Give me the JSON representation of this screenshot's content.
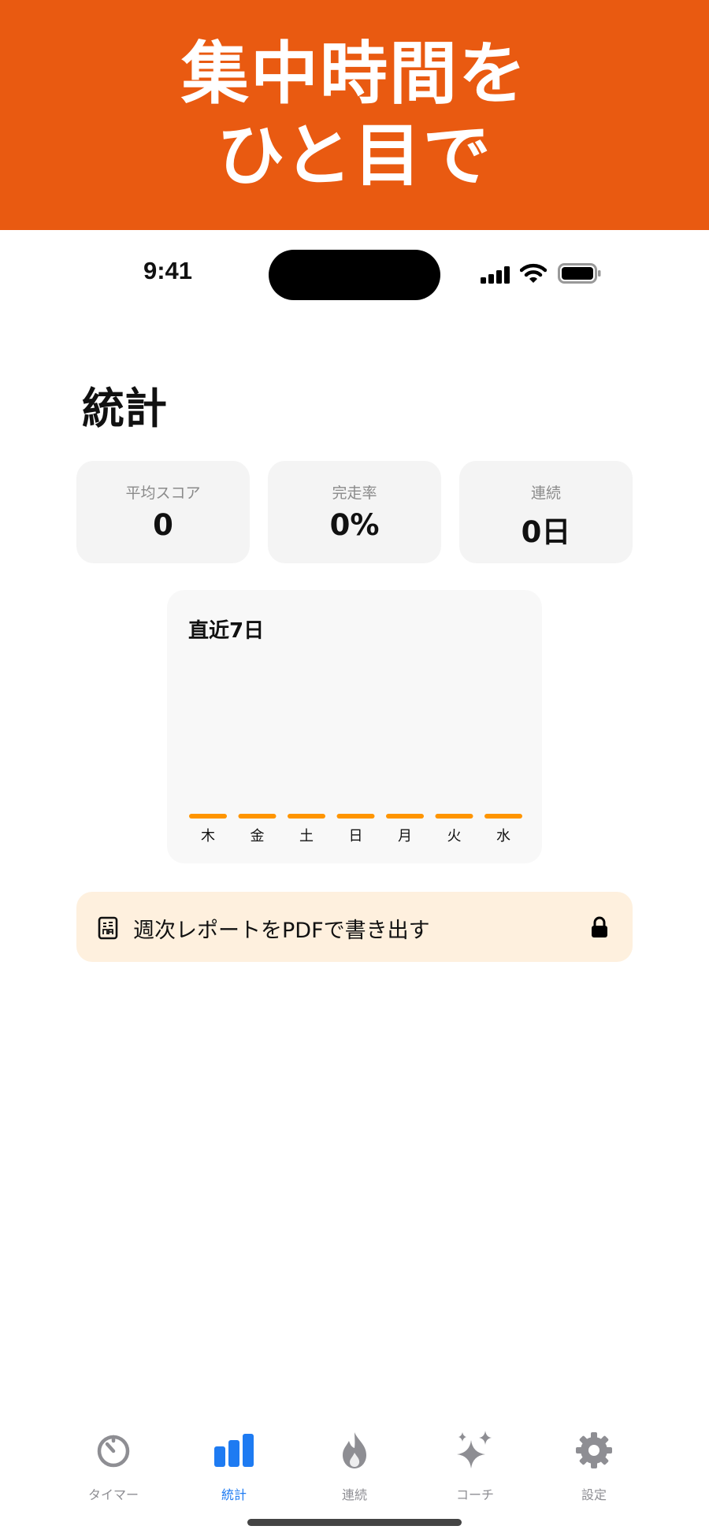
{
  "banner": {
    "line1": "集中時間を",
    "line2": "ひと目で"
  },
  "status_bar": {
    "time": "9:41"
  },
  "page": {
    "title": "統計"
  },
  "stats": [
    {
      "label": "平均スコア",
      "value": "0"
    },
    {
      "label": "完走率",
      "value": "0%"
    },
    {
      "label": "連続",
      "value": "0日"
    }
  ],
  "chart_data": {
    "type": "bar",
    "title": "直近7日",
    "categories": [
      "木",
      "金",
      "土",
      "日",
      "月",
      "火",
      "水"
    ],
    "values": [
      0,
      0,
      0,
      0,
      0,
      0,
      0
    ],
    "color": "#FF9500"
  },
  "pdf_export": {
    "label": "週次レポートをPDFで書き出す",
    "icon": "document-icon",
    "lock_icon": "lock-icon"
  },
  "tab_bar": {
    "active": "stats",
    "items": [
      {
        "key": "timer",
        "label": "タイマー",
        "icon": "timer-icon"
      },
      {
        "key": "stats",
        "label": "統計",
        "icon": "bar-chart-icon"
      },
      {
        "key": "streak",
        "label": "連続",
        "icon": "flame-icon"
      },
      {
        "key": "coach",
        "label": "コーチ",
        "icon": "sparkles-icon"
      },
      {
        "key": "settings",
        "label": "設定",
        "icon": "gear-icon"
      }
    ]
  },
  "colors": {
    "brand": "#E95A11",
    "accent": "#1E7BF2",
    "bar": "#FF9500",
    "inactive": "#8E8E93"
  }
}
